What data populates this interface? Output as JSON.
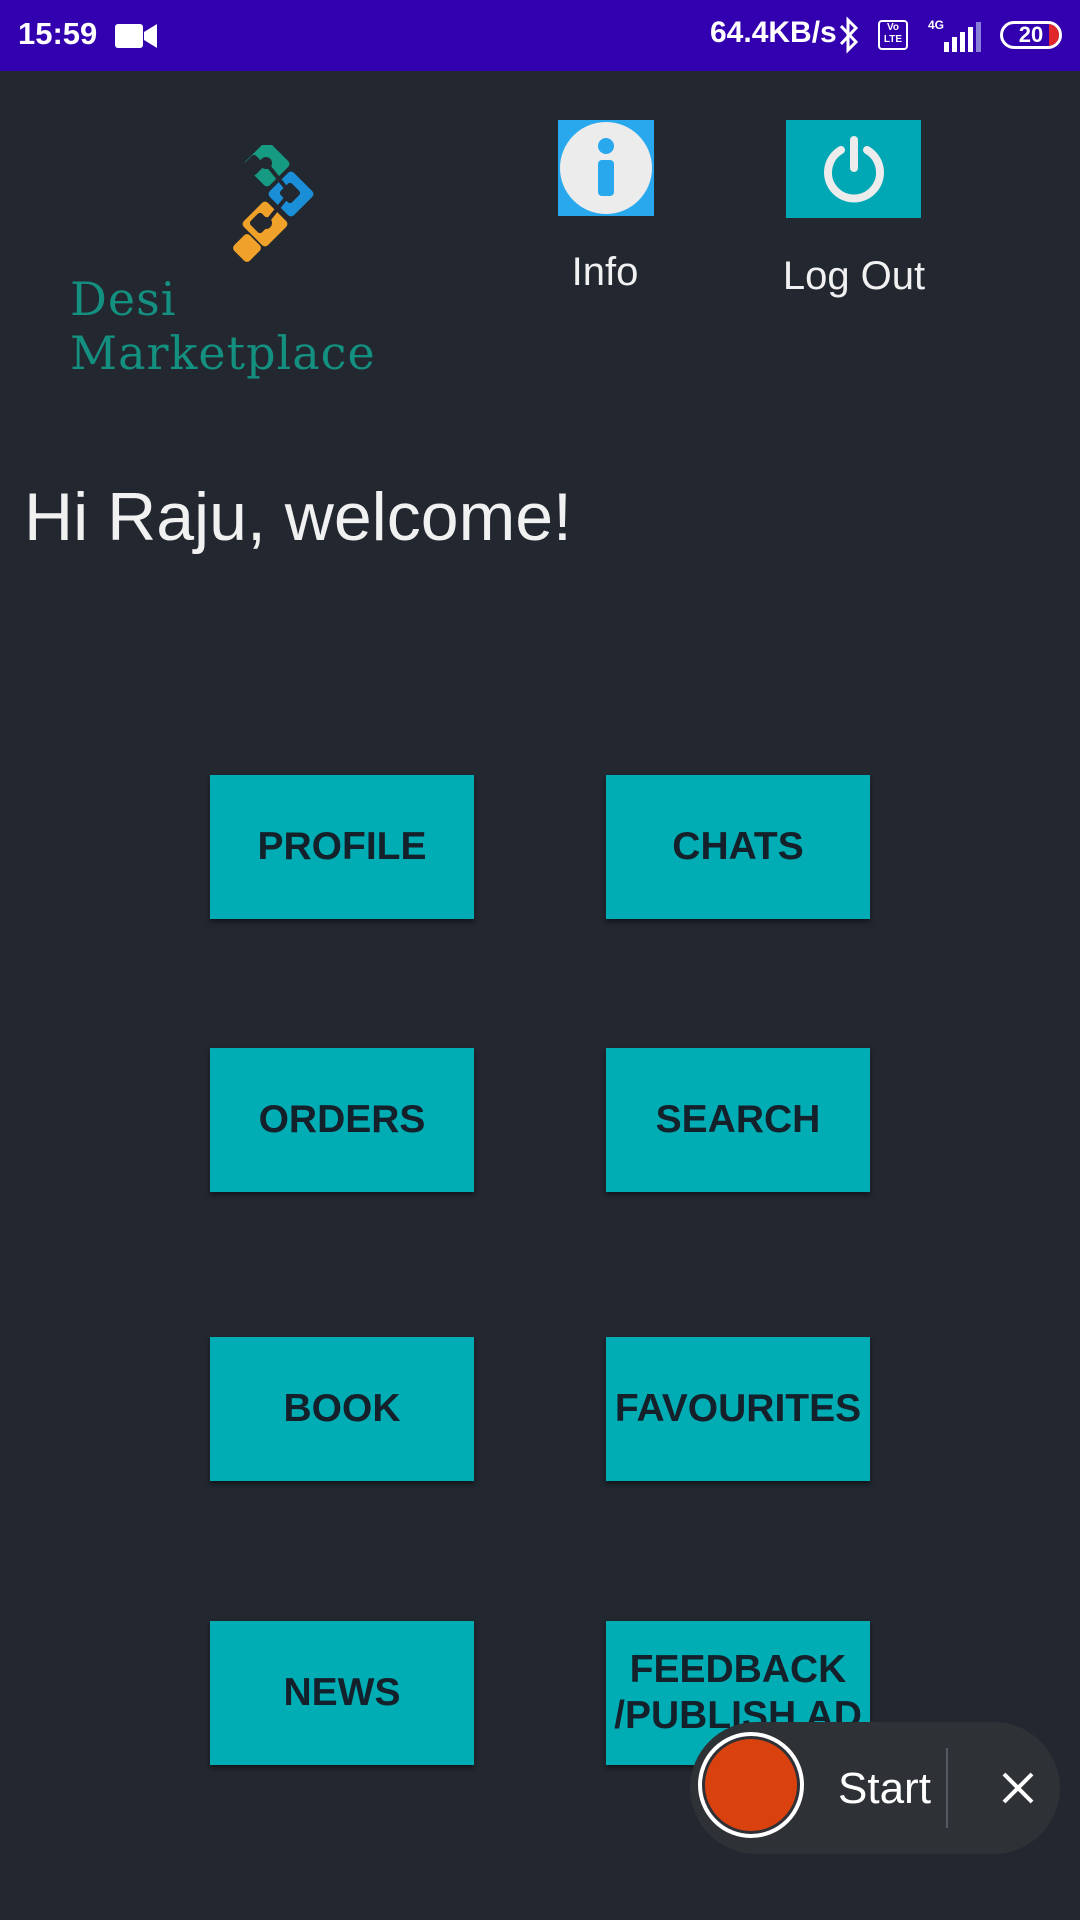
{
  "status_bar": {
    "time": "15:59",
    "network_speed": "64.4KB/s",
    "volte_text": "Vo LTE",
    "network_type": "4G",
    "battery": "20"
  },
  "header": {
    "logo_text": "Desi Marketplace",
    "info_label": "Info",
    "logout_label": "Log Out",
    "info_icon": "info-icon",
    "logout_icon": "power-icon"
  },
  "welcome": "Hi Raju, welcome!",
  "menu": {
    "profile": "PROFILE",
    "chats": "CHATS",
    "orders": "ORDERS",
    "search": "SEARCH",
    "book": "BOOK",
    "favourites": "FAVOURITES",
    "news": "NEWS",
    "feedback": "FEEDBACK /PUBLISH AD"
  },
  "recorder": {
    "start_label": "Start"
  },
  "colors": {
    "background": "#222730",
    "status_bar": "#3300b0",
    "button": "#00adb5",
    "info_button": "#29a8ee",
    "record": "#d9410e",
    "logo_text": "#149080"
  }
}
